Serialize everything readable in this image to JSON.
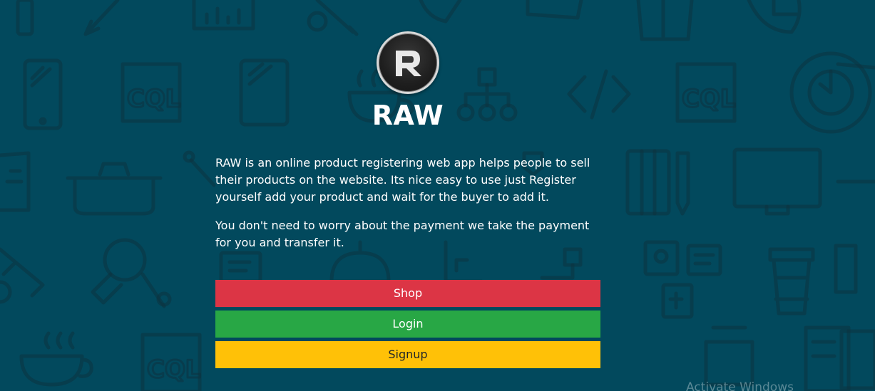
{
  "app": {
    "name": "RAW",
    "logo_letter": "R"
  },
  "description": {
    "paragraph1": "RAW is an online product registering web app helps people to sell their products on the website. Its nice easy to use just Register yourself add your product and wait for the buyer to add it.",
    "paragraph2": "You don't need to worry about the payment we take the payment for you and transfer it."
  },
  "buttons": {
    "shop": "Shop",
    "login": "Login",
    "signup": "Signup"
  },
  "watermark": "Activate Windows",
  "colors": {
    "background": "#02495d",
    "shop": "#dc3545",
    "login": "#28a745",
    "signup": "#ffc107"
  }
}
